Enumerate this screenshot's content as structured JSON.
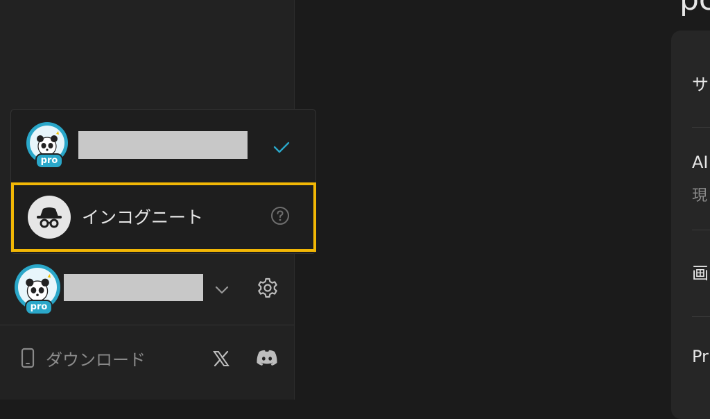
{
  "accounts": {
    "current": {
      "plan_badge": "pro",
      "selected": true
    },
    "incognito": {
      "label": "インコグニート"
    }
  },
  "sidebar_footer": {
    "account_badge": "pro",
    "download_label": "ダウンロード"
  },
  "main": {
    "title_partial": "pc",
    "settings_rows": [
      {
        "label": "サ"
      },
      {
        "label": "AI",
        "sub": "現"
      },
      {
        "label": "画"
      },
      {
        "label": "Pr"
      }
    ]
  },
  "colors": {
    "highlight": "#f2b705",
    "accent_check": "#2aa7c9",
    "avatar_ring": "#2aa7c9"
  },
  "icons": [
    "check-icon",
    "incognito-icon",
    "help-icon",
    "chevron-down-icon",
    "gear-icon",
    "phone-icon",
    "x-icon",
    "discord-icon"
  ]
}
